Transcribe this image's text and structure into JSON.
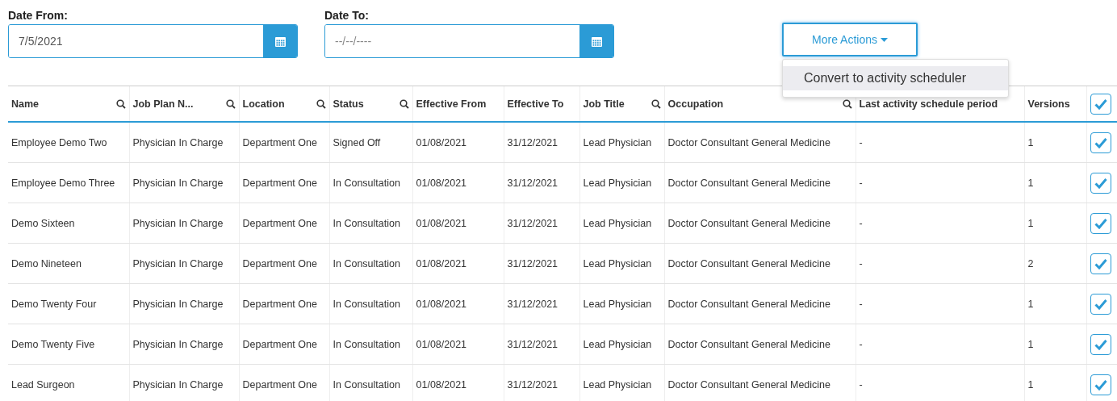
{
  "date_from": {
    "label": "Date From:",
    "value": "7/5/2021"
  },
  "date_to": {
    "label": "Date To:",
    "placeholder": "--/--/----"
  },
  "more_actions": {
    "label": "More Actions",
    "expanded": true,
    "menu_items": [
      "Convert to activity scheduler"
    ]
  },
  "table": {
    "columns": [
      {
        "label": "Name",
        "searchable": true
      },
      {
        "label": "Job Plan N...",
        "searchable": true
      },
      {
        "label": "Location",
        "searchable": true
      },
      {
        "label": "Status",
        "searchable": true
      },
      {
        "label": "Effective From",
        "searchable": false
      },
      {
        "label": "Effective To",
        "searchable": false
      },
      {
        "label": "Job Title",
        "searchable": true
      },
      {
        "label": "Occupation",
        "searchable": true
      },
      {
        "label": "Last activity schedule period",
        "searchable": false
      },
      {
        "label": "Versions",
        "searchable": false
      }
    ],
    "all_checked": true,
    "rows": [
      {
        "cells": [
          "Employee Demo Two",
          "Physician In Charge",
          "Department One",
          "Signed Off",
          "01/08/2021",
          "31/12/2021",
          "Lead Physician",
          "Doctor Consultant General Medicine",
          "-",
          "1"
        ],
        "checked": true
      },
      {
        "cells": [
          "Employee Demo Three",
          "Physician In Charge",
          "Department One",
          "In Consultation",
          "01/08/2021",
          "31/12/2021",
          "Lead Physician",
          "Doctor Consultant General Medicine",
          "-",
          "1"
        ],
        "checked": true
      },
      {
        "cells": [
          "Demo Sixteen",
          "Physician In Charge",
          "Department One",
          "In Consultation",
          "01/08/2021",
          "31/12/2021",
          "Lead Physician",
          "Doctor Consultant General Medicine",
          "-",
          "1"
        ],
        "checked": true
      },
      {
        "cells": [
          "Demo Nineteen",
          "Physician In Charge",
          "Department One",
          "In Consultation",
          "01/08/2021",
          "31/12/2021",
          "Lead Physician",
          "Doctor Consultant General Medicine",
          "-",
          "2"
        ],
        "checked": true
      },
      {
        "cells": [
          "Demo Twenty Four",
          "Physician In Charge",
          "Department One",
          "In Consultation",
          "01/08/2021",
          "31/12/2021",
          "Lead Physician",
          "Doctor Consultant General Medicine",
          "-",
          "1"
        ],
        "checked": true
      },
      {
        "cells": [
          "Demo Twenty Five",
          "Physician In Charge",
          "Department One",
          "In Consultation",
          "01/08/2021",
          "31/12/2021",
          "Lead Physician",
          "Doctor Consultant General Medicine",
          "-",
          "1"
        ],
        "checked": true
      },
      {
        "cells": [
          "Lead Surgeon",
          "Physician In Charge",
          "Department One",
          "In Consultation",
          "01/08/2021",
          "31/12/2021",
          "Lead Physician",
          "Doctor Consultant General Medicine",
          "-",
          "1"
        ],
        "checked": true
      }
    ]
  }
}
